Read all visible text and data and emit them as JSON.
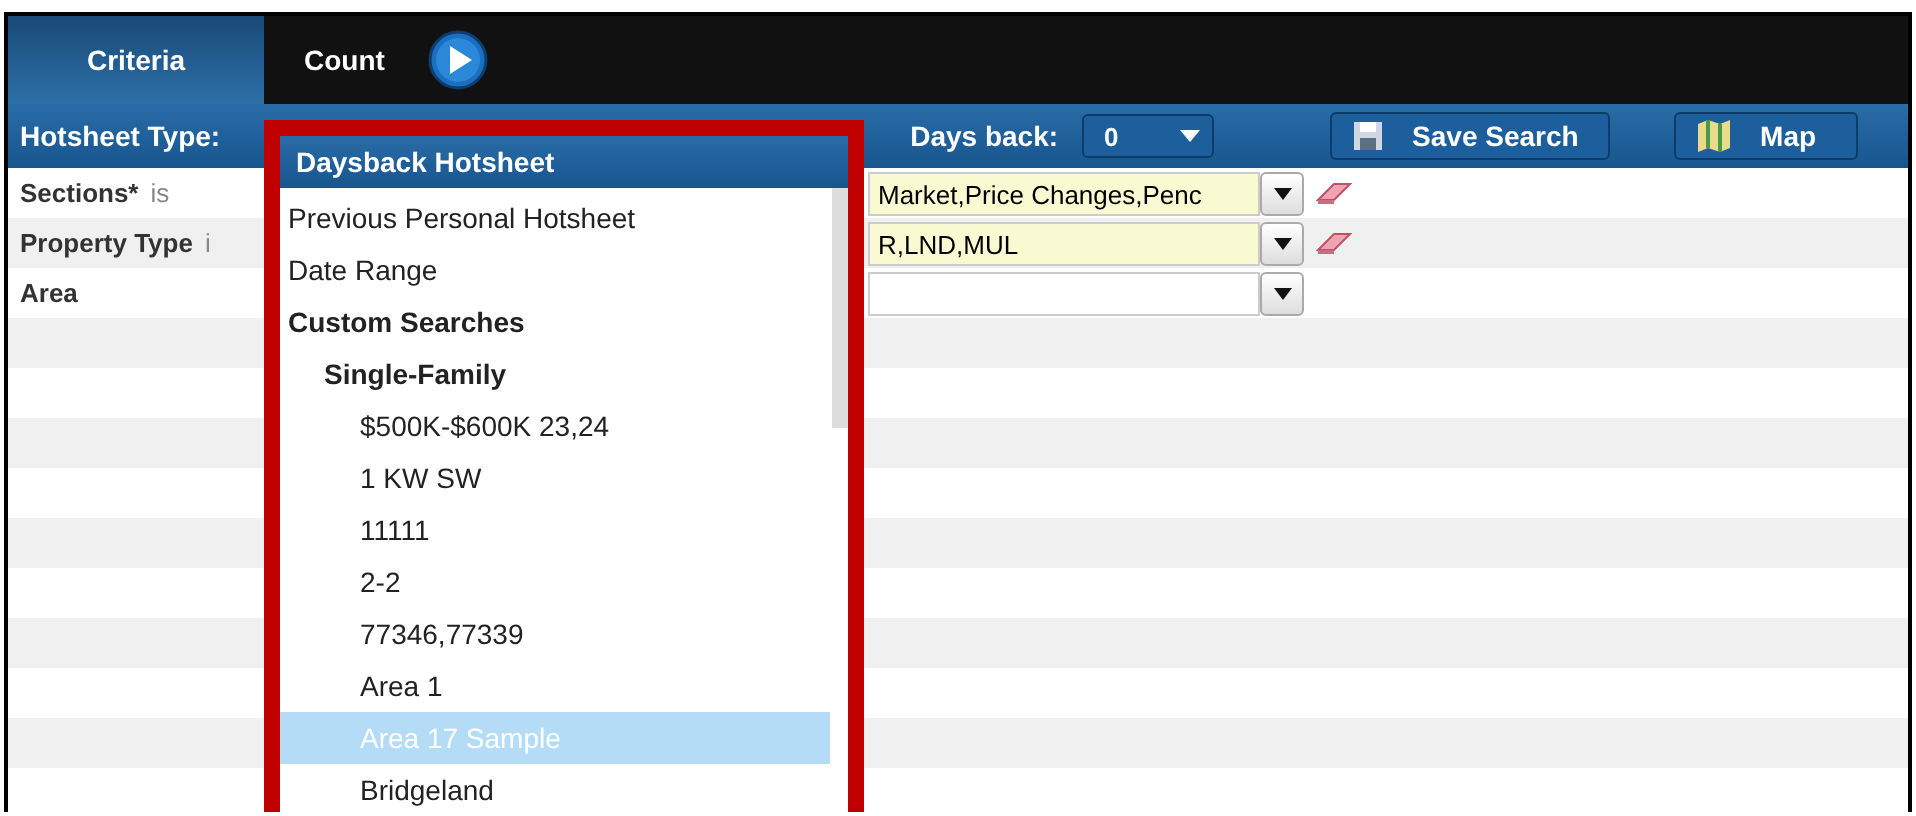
{
  "tabs": [
    {
      "label": "Criteria",
      "selected": true
    },
    {
      "label": "Count",
      "selected": false
    }
  ],
  "toolbar": {
    "hotsheet_label": "Hotsheet Type:",
    "hotsheet_value": "Daysback Hotsheet",
    "days_label": "Days back:",
    "days_value": "0",
    "buttons": [
      {
        "label": "Save Search",
        "kind": "save"
      },
      {
        "label": "Map",
        "kind": "map"
      }
    ]
  },
  "criteria": [
    {
      "label": "Sections*",
      "qualifier": "is",
      "value": "Market,Price Changes,Penc",
      "clearable": true
    },
    {
      "label": "Property Type",
      "qualifier": "i",
      "value": "R,LND,MUL",
      "clearable": true
    },
    {
      "label": "Area",
      "clearable": false
    }
  ],
  "dropdown": {
    "items": [
      {
        "label": "Previous Personal Hotsheet",
        "kind": "option",
        "selected": false
      },
      {
        "label": "Date Range",
        "kind": "option",
        "selected": false
      },
      {
        "label": "Custom Searches",
        "kind": "group",
        "children": [
          {
            "label": "Single-Family",
            "kind": "group",
            "children": [
              {
                "label": "$500K-$600K 23,24",
                "kind": "option",
                "selected": false
              },
              {
                "label": "1 KW SW",
                "kind": "option",
                "selected": false
              },
              {
                "label": "11111",
                "kind": "option",
                "selected": false
              },
              {
                "label": "2-2",
                "kind": "option",
                "selected": false
              },
              {
                "label": "77346,77339",
                "kind": "option",
                "selected": false
              },
              {
                "label": "Area 1",
                "kind": "option",
                "selected": false
              },
              {
                "label": "Area 17 Sample",
                "kind": "option",
                "selected": true
              },
              {
                "label": "Bridgeland",
                "kind": "option",
                "selected": false
              }
            ]
          }
        ]
      }
    ]
  }
}
